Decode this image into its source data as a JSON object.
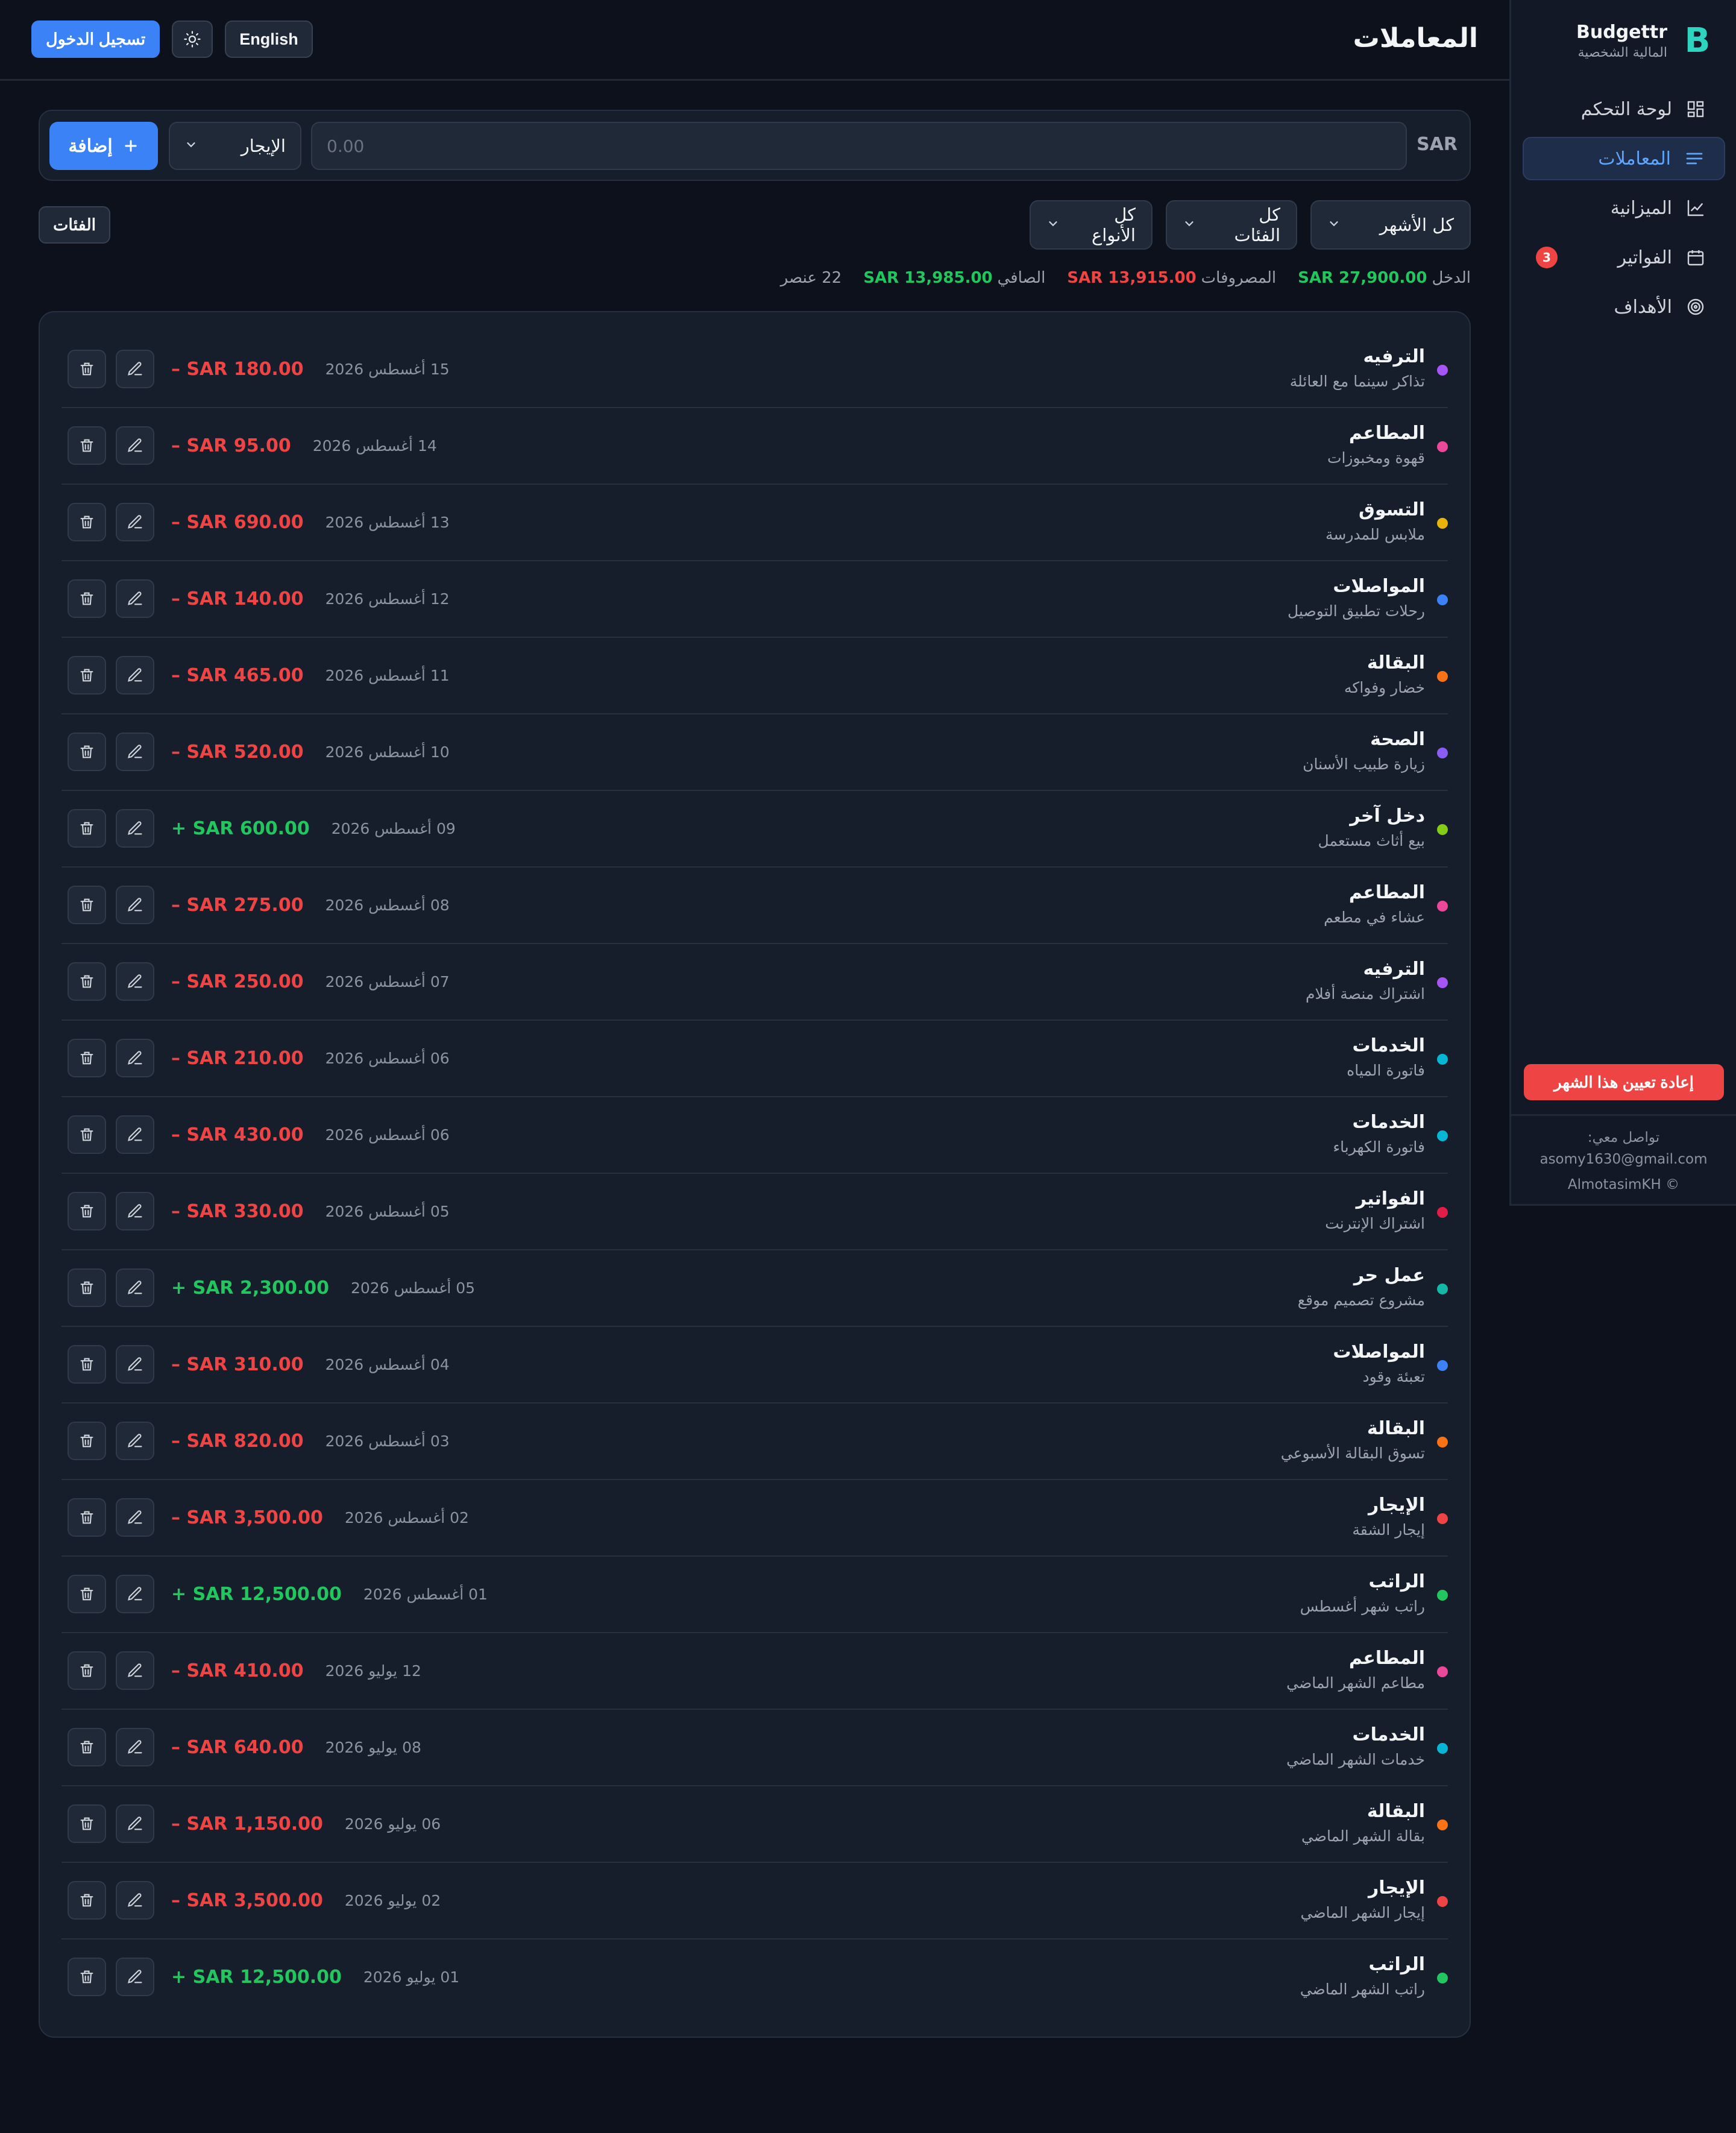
{
  "app": {
    "name": "Budgettr",
    "subtitle": "المالية الشخصية",
    "logo_glyph": "B",
    "accent": "#3b82f6",
    "brand_color": "#2dd4bf"
  },
  "sidebar": {
    "items": [
      {
        "label": "لوحة التحكم",
        "icon": "dashboard-grid-icon",
        "active": false
      },
      {
        "label": "المعاملات",
        "icon": "list-lines-icon",
        "active": true
      },
      {
        "label": "الميزانية",
        "icon": "line-chart-icon",
        "active": false
      },
      {
        "label": "الفواتير",
        "icon": "calendar-icon",
        "active": false,
        "badge": "3"
      },
      {
        "label": "الأهداف",
        "icon": "target-icon",
        "active": false
      }
    ],
    "reset_label": "إعادة تعيين هذا الشهر",
    "contact_label": "تواصل معي:",
    "contact_email": "asomy1630@gmail.com",
    "copyright": "AlmotasimKH ©"
  },
  "header": {
    "title": "المعاملات",
    "login_label": "تسجيل الدخول",
    "language_label": "English",
    "theme_icon": "sun-icon"
  },
  "add_form": {
    "currency": "SAR",
    "amount_placeholder": "0.00",
    "category_selected": "الإيجار",
    "add_label": "إضافة"
  },
  "filters": {
    "months": "كل الأشهر",
    "categories": "كل الفئات",
    "types": "كل الأنواع",
    "categories_button": "الفئات"
  },
  "summary": {
    "income_label": "الدخل",
    "income_value": "SAR 27,900.00",
    "expenses_label": "المصروفات",
    "expenses_value": "SAR 13,915.00",
    "net_label": "الصافي",
    "net_value": "SAR 13,985.00",
    "count": "22 عنصر"
  },
  "transactions": [
    {
      "category": "الترفيه",
      "description": "تذاكر سينما مع العائلة",
      "date": "15 أغسطس 2026",
      "amount": "– SAR 180.00",
      "type": "expense",
      "color": "#a855f7"
    },
    {
      "category": "المطاعم",
      "description": "قهوة ومخبوزات",
      "date": "14 أغسطس 2026",
      "amount": "– SAR 95.00",
      "type": "expense",
      "color": "#ec4899"
    },
    {
      "category": "التسوق",
      "description": "ملابس للمدرسة",
      "date": "13 أغسطس 2026",
      "amount": "– SAR 690.00",
      "type": "expense",
      "color": "#eab308"
    },
    {
      "category": "المواصلات",
      "description": "رحلات تطبيق التوصيل",
      "date": "12 أغسطس 2026",
      "amount": "– SAR 140.00",
      "type": "expense",
      "color": "#3b82f6"
    },
    {
      "category": "البقالة",
      "description": "خضار وفواكه",
      "date": "11 أغسطس 2026",
      "amount": "– SAR 465.00",
      "type": "expense",
      "color": "#f97316"
    },
    {
      "category": "الصحة",
      "description": "زيارة طبيب الأسنان",
      "date": "10 أغسطس 2026",
      "amount": "– SAR 520.00",
      "type": "expense",
      "color": "#8b5cf6"
    },
    {
      "category": "دخل آخر",
      "description": "بيع أثاث مستعمل",
      "date": "09 أغسطس 2026",
      "amount": "+ SAR 600.00",
      "type": "income",
      "color": "#84cc16"
    },
    {
      "category": "المطاعم",
      "description": "عشاء في مطعم",
      "date": "08 أغسطس 2026",
      "amount": "– SAR 275.00",
      "type": "expense",
      "color": "#ec4899"
    },
    {
      "category": "الترفيه",
      "description": "اشتراك منصة أفلام",
      "date": "07 أغسطس 2026",
      "amount": "– SAR 250.00",
      "type": "expense",
      "color": "#a855f7"
    },
    {
      "category": "الخدمات",
      "description": "فاتورة المياه",
      "date": "06 أغسطس 2026",
      "amount": "– SAR 210.00",
      "type": "expense",
      "color": "#06b6d4"
    },
    {
      "category": "الخدمات",
      "description": "فاتورة الكهرباء",
      "date": "06 أغسطس 2026",
      "amount": "– SAR 430.00",
      "type": "expense",
      "color": "#06b6d4"
    },
    {
      "category": "الفواتير",
      "description": "اشتراك الإنترنت",
      "date": "05 أغسطس 2026",
      "amount": "– SAR 330.00",
      "type": "expense",
      "color": "#e11d48"
    },
    {
      "category": "عمل حر",
      "description": "مشروع تصميم موقع",
      "date": "05 أغسطس 2026",
      "amount": "+ SAR 2,300.00",
      "type": "income",
      "color": "#14b8a6"
    },
    {
      "category": "المواصلات",
      "description": "تعبئة وقود",
      "date": "04 أغسطس 2026",
      "amount": "– SAR 310.00",
      "type": "expense",
      "color": "#3b82f6"
    },
    {
      "category": "البقالة",
      "description": "تسوق البقالة الأسبوعي",
      "date": "03 أغسطس 2026",
      "amount": "– SAR 820.00",
      "type": "expense",
      "color": "#f97316"
    },
    {
      "category": "الإيجار",
      "description": "إيجار الشقة",
      "date": "02 أغسطس 2026",
      "amount": "– SAR 3,500.00",
      "type": "expense",
      "color": "#ef4444"
    },
    {
      "category": "الراتب",
      "description": "راتب شهر أغسطس",
      "date": "01 أغسطس 2026",
      "amount": "+ SAR 12,500.00",
      "type": "income",
      "color": "#22c55e"
    },
    {
      "category": "المطاعم",
      "description": "مطاعم الشهر الماضي",
      "date": "12 يوليو 2026",
      "amount": "– SAR 410.00",
      "type": "expense",
      "color": "#ec4899"
    },
    {
      "category": "الخدمات",
      "description": "خدمات الشهر الماضي",
      "date": "08 يوليو 2026",
      "amount": "– SAR 640.00",
      "type": "expense",
      "color": "#06b6d4"
    },
    {
      "category": "البقالة",
      "description": "بقالة الشهر الماضي",
      "date": "06 يوليو 2026",
      "amount": "– SAR 1,150.00",
      "type": "expense",
      "color": "#f97316"
    },
    {
      "category": "الإيجار",
      "description": "إيجار الشهر الماضي",
      "date": "02 يوليو 2026",
      "amount": "– SAR 3,500.00",
      "type": "expense",
      "color": "#ef4444"
    },
    {
      "category": "الراتب",
      "description": "راتب الشهر الماضي",
      "date": "01 يوليو 2026",
      "amount": "+ SAR 12,500.00",
      "type": "income",
      "color": "#22c55e"
    }
  ]
}
